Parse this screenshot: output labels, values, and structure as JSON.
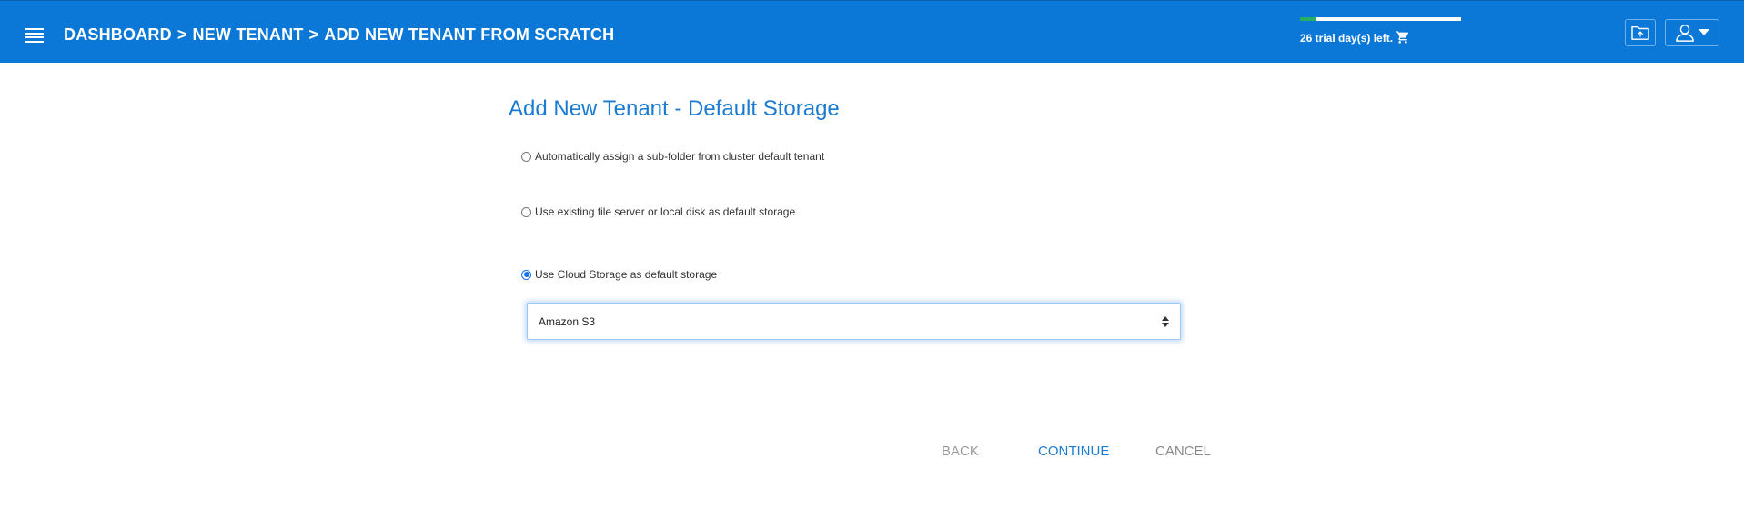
{
  "header": {
    "breadcrumb": [
      "DASHBOARD",
      "NEW TENANT",
      "ADD NEW TENANT FROM SCRATCH"
    ],
    "separator": ">",
    "trial_text": "26 trial day(s) left.",
    "trial_progress": 0.1,
    "icons": [
      "hamburger-menu-icon",
      "cart-icon",
      "folder-icon",
      "user-icon",
      "caret-down-icon"
    ],
    "colors": {
      "bar": "#0b78d7",
      "progress": "#27ae60"
    }
  },
  "main": {
    "title": "Add New Tenant - Default Storage",
    "options": [
      {
        "label": "Automatically assign a sub-folder from cluster default tenant",
        "checked": false
      },
      {
        "label": "Use existing file server or local disk as default storage",
        "checked": false
      },
      {
        "label": "Use Cloud Storage as default storage",
        "checked": true
      }
    ],
    "storage_select": {
      "value": "Amazon S3"
    },
    "actions": {
      "back": "BACK",
      "continue": "CONTINUE",
      "cancel": "CANCEL"
    },
    "accent_color": "#1a7bd1"
  }
}
